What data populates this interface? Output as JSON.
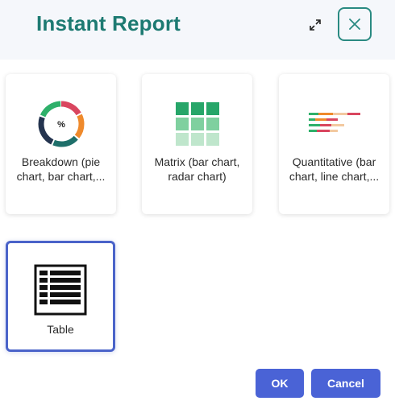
{
  "dialog": {
    "title": "Instant Report",
    "expand_icon": "expand-icon",
    "close_icon": "close-icon"
  },
  "options": [
    {
      "label": "Breakdown (pie chart, bar chart,...",
      "icon": "donut-chart-icon",
      "selected": false
    },
    {
      "label": "Matrix (bar chart, radar chart)",
      "icon": "matrix-grid-icon",
      "selected": false
    },
    {
      "label": "Quantitative (bar chart, line chart,...",
      "icon": "stacked-bars-icon",
      "selected": false
    },
    {
      "label": "Table",
      "icon": "table-icon",
      "selected": true
    }
  ],
  "donut_icon_text": "%",
  "buttons": {
    "ok": "OK",
    "cancel": "Cancel"
  },
  "colors": {
    "title": "#1d7a72",
    "selected_border": "#4a63c9",
    "button": "#4a63d6"
  }
}
